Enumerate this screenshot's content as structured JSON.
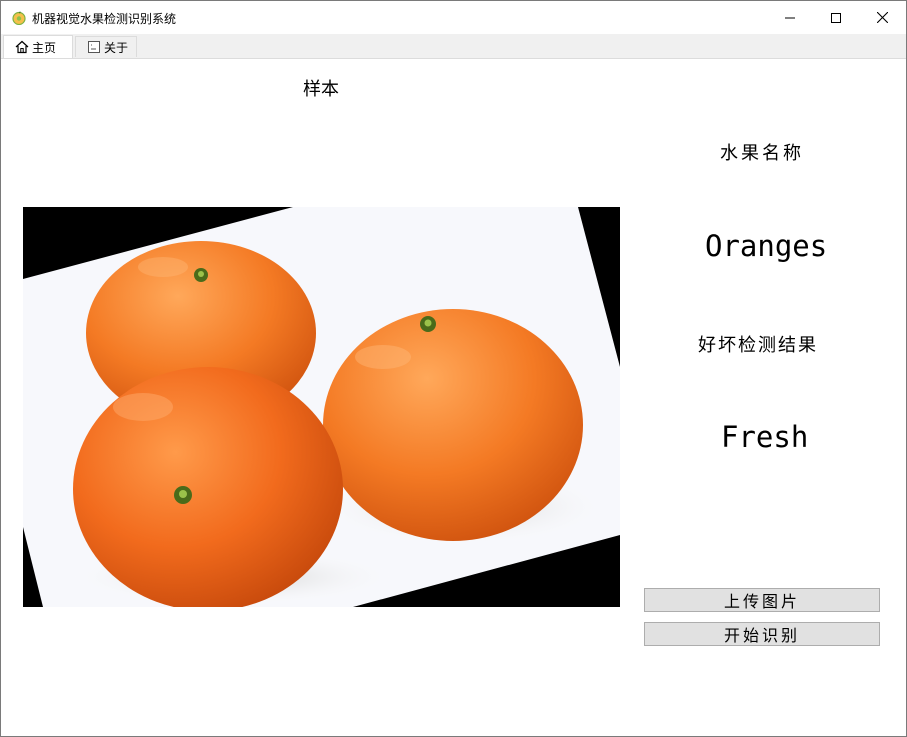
{
  "window": {
    "title": "机器视觉水果检测识别系统",
    "icon": "fruit-app-icon"
  },
  "tabs": [
    {
      "label": "主页",
      "icon": "home-icon",
      "active": true
    },
    {
      "label": "关于",
      "icon": "document-icon",
      "active": false
    }
  ],
  "main": {
    "sample_label": "样本",
    "fruit_name_label": "水果名称",
    "fruit_name_value": "Oranges",
    "quality_label": "好坏检测结果",
    "quality_value": "Fresh",
    "image": {
      "subject": "three mandarin oranges on white background, rotated"
    }
  },
  "buttons": {
    "upload": "上传图片",
    "start": "开始识别"
  }
}
